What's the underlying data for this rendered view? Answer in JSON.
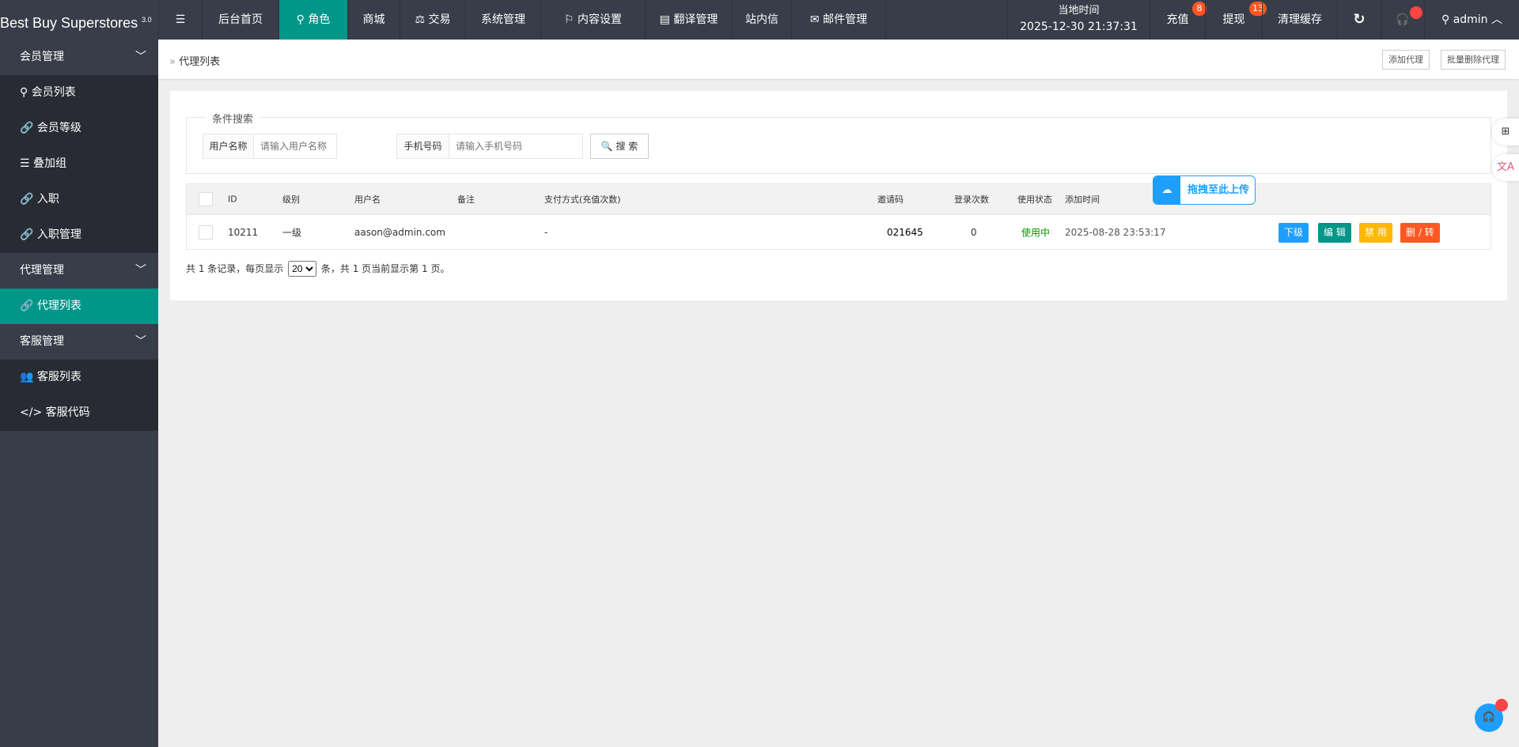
{
  "header": {
    "logo": "Best Buy Superstores",
    "version": "3.0",
    "nav": [
      {
        "label": "后台首页"
      },
      {
        "label": "角色",
        "icon": "user-icon",
        "active": true
      },
      {
        "label": "商城"
      },
      {
        "label": "交易",
        "icon": "scale-icon"
      },
      {
        "label": "系统管理"
      },
      {
        "label": "内容设置",
        "icon": "flag-icon"
      },
      {
        "label": "翻译管理",
        "icon": "translate-icon"
      },
      {
        "label": "站内信"
      },
      {
        "label": "邮件管理",
        "icon": "mail-icon"
      }
    ],
    "time_label": "当地时间",
    "time_value": "2025-12-30 21:37:31",
    "recharge": "充值",
    "recharge_count": "8",
    "withdraw": "提现",
    "withdraw_count": "13",
    "clear_cache": "清理缓存",
    "user": "admin"
  },
  "sidebar": {
    "groups": [
      {
        "label": "会员管理",
        "items": [
          {
            "label": "会员列表",
            "icon": "user-icon"
          },
          {
            "label": "会员等级",
            "icon": "link-icon"
          },
          {
            "label": "叠加组",
            "icon": "list-icon"
          },
          {
            "label": "入职",
            "icon": "link-icon"
          },
          {
            "label": "入职管理",
            "icon": "link-icon"
          }
        ]
      },
      {
        "label": "代理管理",
        "items": [
          {
            "label": "代理列表",
            "icon": "link-icon",
            "active": true
          }
        ]
      },
      {
        "label": "客服管理",
        "items": [
          {
            "label": "客服列表",
            "icon": "users-icon"
          },
          {
            "label": "客服代码",
            "icon": "code-icon"
          }
        ]
      }
    ]
  },
  "breadcrumb": "代理列表",
  "actions": {
    "add": "添加代理",
    "batch_delete": "批量删除代理"
  },
  "search": {
    "legend": "条件搜索",
    "username_label": "用户名称",
    "username_placeholder": "请输入用户名称",
    "phone_label": "手机号码",
    "phone_placeholder": "请输入手机号码",
    "button": "搜 索"
  },
  "table": {
    "headers": [
      "ID",
      "级别",
      "用户名",
      "备注",
      "支付方式(充值次数)",
      "邀请码",
      "登录次数",
      "使用状态",
      "添加时间"
    ],
    "rows": [
      {
        "id": "10211",
        "level": "一级",
        "username": "aason@admin.com",
        "note": "",
        "payment": "-",
        "invite": "021645",
        "logins": "0",
        "status": "使用中",
        "added": "2025-08-28 23:53:17"
      }
    ],
    "row_actions": [
      "下级",
      "编 辑",
      "禁 用",
      "删 / 转"
    ]
  },
  "pagination": {
    "prefix": "共 1 条记录，每页显示",
    "page_size": "20",
    "suffix": "条，共 1 页当前显示第 1 页。"
  },
  "upload_hint": "拖拽至此上传",
  "colors": {
    "topbar": "#393d49",
    "accent": "#009688",
    "blue": "#1e9fff",
    "orange": "#ffb800",
    "red": "#ff5722",
    "status_green": "#009900"
  }
}
